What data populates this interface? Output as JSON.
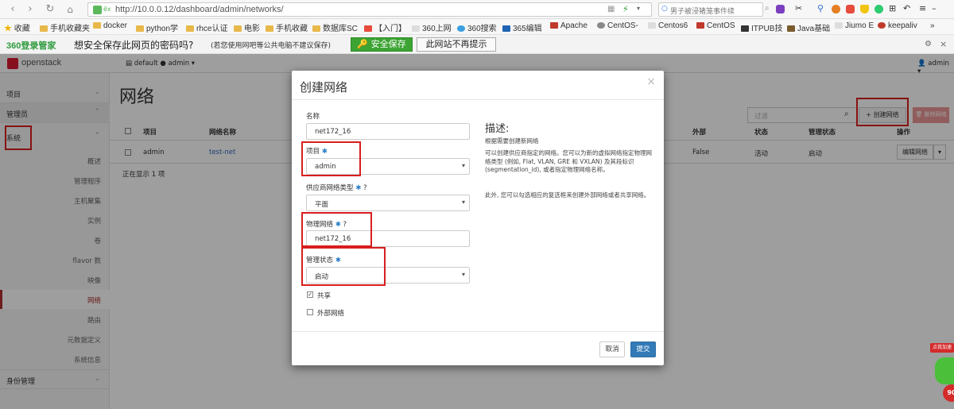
{
  "browser": {
    "url": "http://10.0.0.12/dashboard/admin/networks/",
    "search_text": "男子被浸猪笼事件续",
    "shield_label": "ēx"
  },
  "bookmarks": {
    "favorites_label": "收藏",
    "items": [
      "手机收藏夹",
      "docker",
      "python学",
      "rhce认证",
      "电影",
      "手机收藏",
      "数据库SC",
      "【入门】",
      "360上网",
      "360搜索",
      "365编辑",
      "Apache",
      "CentOS-",
      "Centos6",
      "CentOS",
      "ITPUB技",
      "Java基础",
      "Jiumo E",
      "keepaliv"
    ],
    "more": "»"
  },
  "password_bar": {
    "brand": "360登录管家",
    "question": "想安全保存此网页的密码吗?",
    "hint": "(若您使用网吧等公共电脑不建议保存)",
    "save_label": "安全保存",
    "never_label": "此网站不再提示"
  },
  "openstack": {
    "logo": "openstack",
    "project_selector": "default ● admin ▾",
    "user_menu": "admin ▾"
  },
  "sidebar": {
    "project_label": "项目",
    "admin_label": "管理员",
    "system_label": "系统",
    "items": [
      "概述",
      "管理程序",
      "主机聚集",
      "实例",
      "卷",
      "flavor 数",
      "映像",
      "网络",
      "路由",
      "元数据定义",
      "系统信息"
    ],
    "identity_label": "身份管理"
  },
  "page": {
    "title": "网络",
    "filter_placeholder": "过滤",
    "create_button": "+ 创建网络",
    "delete_button": "🗑 删除网络",
    "columns": [
      "项目",
      "网络名称",
      "外部",
      "状态",
      "管理状态",
      "操作"
    ],
    "rows": [
      {
        "project": "admin",
        "name": "test-net",
        "external": "False",
        "status": "活动",
        "admin_state": "启动",
        "action": "编辑网络"
      }
    ],
    "count_text": "正在显示 1 项"
  },
  "modal": {
    "title": "创建网络",
    "close": "×",
    "name_label": "名称",
    "name_value": "net172_16",
    "project_label": "项目",
    "project_value": "admin",
    "provider_label": "供应商网络类型",
    "provider_value": "平面",
    "physical_label": "物理网络",
    "physical_value": "net172_16",
    "admin_state_label": "管理状态",
    "admin_state_value": "启动",
    "shared_label": "共享",
    "external_label": "外部网络",
    "desc_heading": "描述:",
    "desc_line1": "根据需要创建新网络",
    "desc_line2": "可以创建供应商指定的网络。您可以为新的虚拟网络指定物理网络类型 (例如, Flat, VLAN, GRE 和 VXLAN) 及其段标识 (segmentation_id), 或者指定物理网络名称。",
    "desc_line3": "此外, 您可以勾选相应的复选框来创建外部网络或者共享网络。",
    "cancel_label": "取消",
    "submit_label": "提交"
  },
  "widget": {
    "label": "点我加速",
    "value": "90"
  }
}
